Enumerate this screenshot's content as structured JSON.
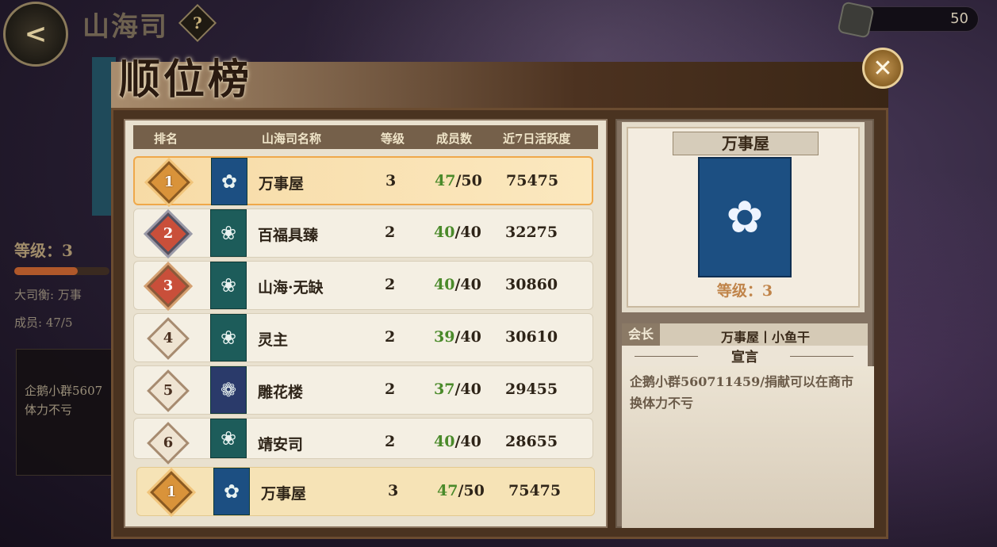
{
  "header": {
    "title": "山海司",
    "help_label": "?",
    "back_label": "<",
    "currency_value": "50"
  },
  "background_panel": {
    "level_text": "等级：3",
    "leader_text": "大司衡: 万事",
    "members_text": "成员: 47/5",
    "notice_text": "企鹅小群5607 体力不亏"
  },
  "modal": {
    "title": "顺位榜",
    "close_label": "✕"
  },
  "table": {
    "columns": [
      "排名",
      "山海司名称",
      "等级",
      "成员数",
      "近7日活跃度"
    ],
    "rows": [
      {
        "rank": "1",
        "name": "万事屋",
        "level": "3",
        "members_cur": "47",
        "members_max": "/50",
        "activity": "75475"
      },
      {
        "rank": "2",
        "name": "百福具臻",
        "level": "2",
        "members_cur": "40",
        "members_max": "/40",
        "activity": "32275"
      },
      {
        "rank": "3",
        "name": "山海·无缺",
        "level": "2",
        "members_cur": "40",
        "members_max": "/40",
        "activity": "30860"
      },
      {
        "rank": "4",
        "name": "灵主",
        "level": "2",
        "members_cur": "39",
        "members_max": "/40",
        "activity": "30610"
      },
      {
        "rank": "5",
        "name": "雕花楼",
        "level": "2",
        "members_cur": "37",
        "members_max": "/40",
        "activity": "29455"
      },
      {
        "rank": "6",
        "name": "靖安司",
        "level": "2",
        "members_cur": "40",
        "members_max": "/40",
        "activity": "28655"
      }
    ],
    "mine": {
      "rank": "1",
      "name": "万事屋",
      "level": "3",
      "members_cur": "47",
      "members_max": "/50",
      "activity": "75475"
    }
  },
  "detail": {
    "name": "万事屋",
    "level_text": "等级：3",
    "leader_tag": "会长",
    "leader_name": "万事屋丨小鱼干",
    "declaration_title": "宣言",
    "declaration": "企鹅小群560711459/捐献可以在商市换体力不亏"
  },
  "colors": {
    "accent_gold": "#efa84a",
    "member_green": "#4a8a2a",
    "panel_brown": "#4a3320"
  },
  "icons": {
    "back": "arrow-left-icon",
    "help": "question-icon",
    "close": "close-icon",
    "currency": "stamina-icon",
    "emblem": "cloud-flower-emblem-icon"
  }
}
